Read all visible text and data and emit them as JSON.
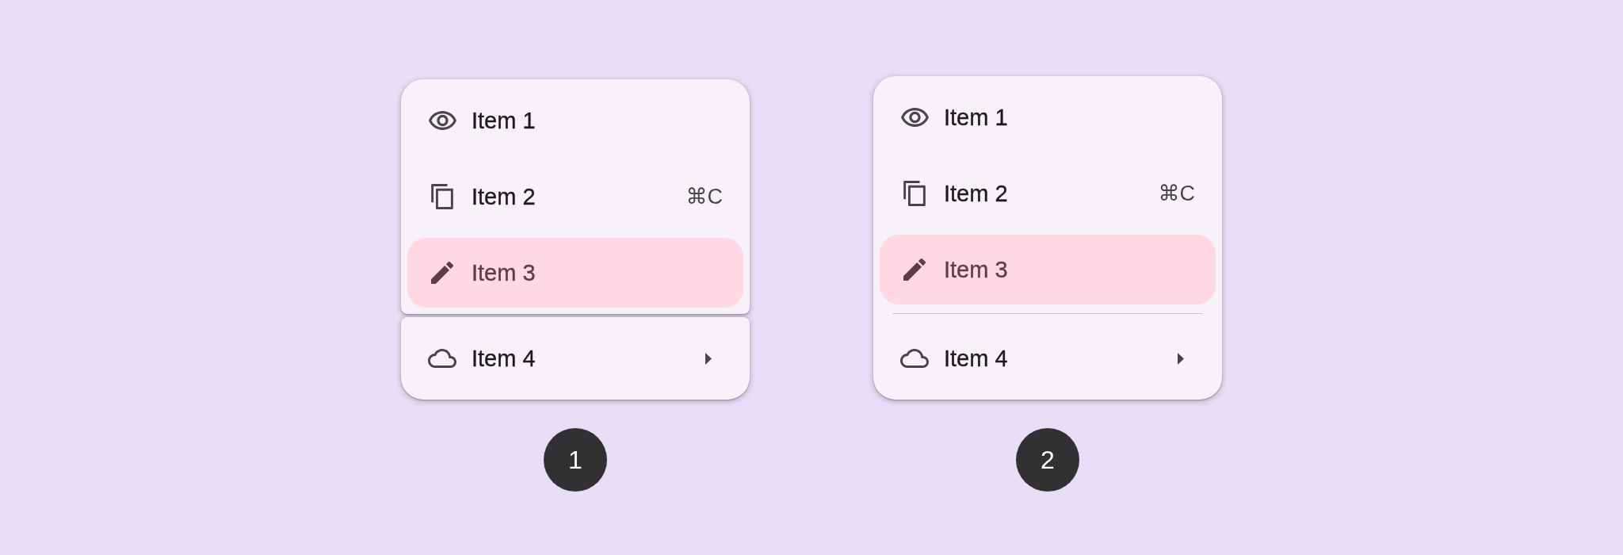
{
  "menus": [
    {
      "kind": "split",
      "sections": [
        {
          "items": [
            {
              "label": "Item 1",
              "selected": false,
              "submenu": false
            },
            {
              "label": "Item 2",
              "shortcut": "⌘C",
              "selected": false,
              "submenu": false
            },
            {
              "label": "Item 3",
              "selected": true,
              "submenu": false
            }
          ]
        },
        {
          "items": [
            {
              "label": "Item 4",
              "selected": false,
              "submenu": true
            }
          ]
        }
      ],
      "badge": "1"
    },
    {
      "kind": "divided",
      "sections": [
        {
          "items": [
            {
              "label": "Item 1",
              "selected": false,
              "submenu": false
            },
            {
              "label": "Item 2",
              "shortcut": "⌘C",
              "selected": false,
              "submenu": false
            },
            {
              "label": "Item 3",
              "selected": true,
              "submenu": false
            }
          ]
        },
        {
          "items": [
            {
              "label": "Item 4",
              "selected": false,
              "submenu": true
            }
          ]
        }
      ],
      "badge": "2"
    }
  ]
}
